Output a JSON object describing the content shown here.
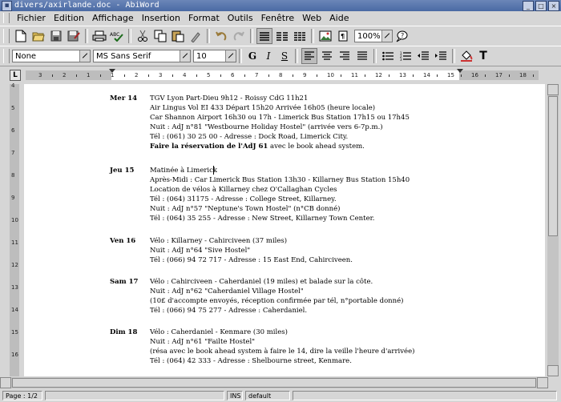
{
  "window": {
    "title": "divers/axirlande.doc - AbiWord"
  },
  "menu": [
    "Fichier",
    "Edition",
    "Affichage",
    "Insertion",
    "Format",
    "Outils",
    "Fenêtre",
    "Web",
    "Aide"
  ],
  "format_bar": {
    "style": "None",
    "font": "MS Sans Serif",
    "size": "10",
    "zoom": "100%"
  },
  "ruler": {
    "h_labels": [
      "3",
      "2",
      "1",
      "1",
      "2",
      "3",
      "4",
      "5",
      "6",
      "7",
      "8",
      "9",
      "10",
      "11",
      "12",
      "13",
      "14",
      "15",
      "16",
      "17",
      "18"
    ],
    "v_labels": [
      "4",
      "5",
      "6",
      "7",
      "8",
      "9",
      "10",
      "11",
      "12",
      "13",
      "14",
      "15",
      "16"
    ]
  },
  "entries": [
    {
      "date": "Mer 14",
      "lines": [
        "TGV Lyon Part-Dieu 9h12 - Roissy CdG 11h21",
        "Air Lingus Vol EI 433  Départ 15h20 Arrivée 16h05 (heure locale)",
        "Car Shannon Airport 16h30 ou 17h - Limerick Bus Station 17h15 ou 17h45",
        "Nuit : AdJ n°81 \"Westbourne Holiday Hostel\" (arrivée vers 6-7p.m.)",
        "Tél :  (061) 30 25 00 - Adresse : Dock Road, Limerick City.",
        "Faire la réservation de l'AdJ 61|avec le book ahead system."
      ]
    },
    {
      "date": "Jeu 15",
      "lines": [
        "Matinée à Limerick",
        "Après-Midi : Car Limerick Bus Station 13h30 - Killarney Bus Station 15h40",
        "Location de vélos à Killarney chez O'Callaghan Cycles",
        "Tél : (064) 31175 - Adresse : College Street, Killarney.",
        "Nuit : AdJ n°57 \"Neptune's Town Hostel\" (n°CB donné)",
        "Tél : (064) 35 255 - Adresse :  New Street, Killarney Town Center."
      ]
    },
    {
      "date": "Ven 16",
      "lines": [
        "Vélo : Killarney - Cahirciveen (37 miles)",
        "Nuit : AdJ n°64 \"Sive Hostel\"",
        "Tél :  (066) 94 72 717 - Adresse : 15 East End, Cahirciveen."
      ]
    },
    {
      "date": "Sam 17",
      "lines": [
        "Vélo : Cahirciveen - Caherdaniel (19 miles) et balade sur la côte.",
        "Nuit : AdJ n°62 \"Caherdaniel Village Hostel\"",
        "(10£ d'accompte envoyés, réception confirmée par tél, n°portable donné)",
        "Tél :  (066) 94 75 277 - Adresse : Caherdaniel."
      ]
    },
    {
      "date": "Dim 18",
      "lines": [
        "Vélo : Caherdaniel - Kenmare (30 miles)",
        "Nuit : AdJ n°61 \"Failte Hostel\"",
        "(résa avec le book ahead system à faire le 14, dire la veille l'heure d'arrivée)",
        "Tél : (064) 42 333 - Adresse : Shelbourne street, Kenmare."
      ]
    }
  ],
  "status": {
    "page": "Page : 1/2",
    "mode": "INS",
    "style": "default"
  }
}
